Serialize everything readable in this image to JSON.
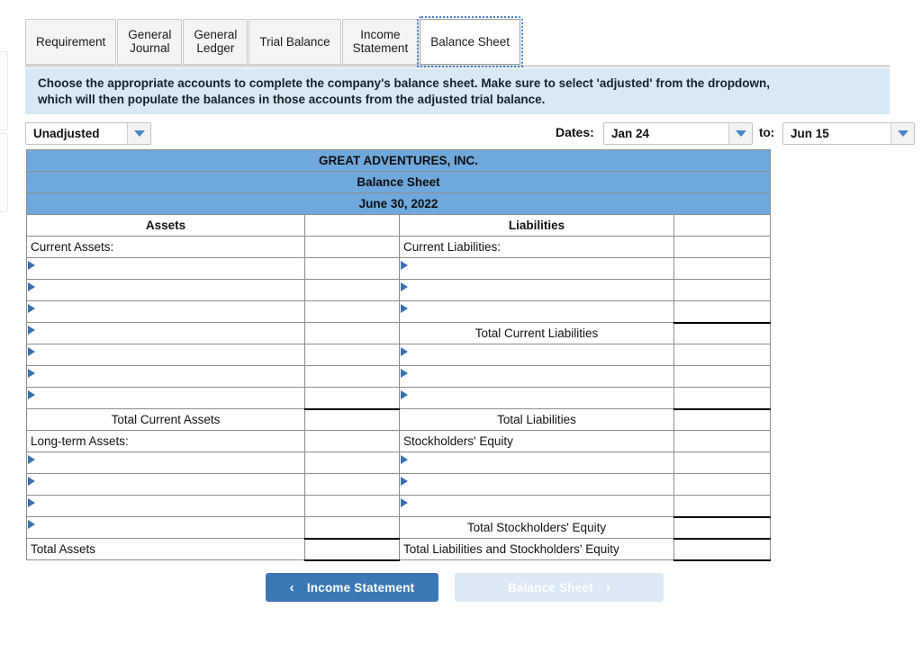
{
  "tabs": [
    {
      "label": "Requirement",
      "active": false
    },
    {
      "label": "General\nJournal",
      "active": false
    },
    {
      "label": "General\nLedger",
      "active": false
    },
    {
      "label": "Trial Balance",
      "active": false
    },
    {
      "label": "Income\nStatement",
      "active": false
    },
    {
      "label": "Balance Sheet",
      "active": true
    }
  ],
  "banner": {
    "line1": "Choose the appropriate accounts to complete the company's balance sheet. Make sure to select 'adjusted' from the dropdown,",
    "line2": "which will then populate the balances in those accounts from the adjusted trial balance."
  },
  "toolbar": {
    "adjustment_value": "Unadjusted",
    "dates_label": "Dates:",
    "date_from_value": "Jan 24",
    "to_label": "to:",
    "date_to_value": "Jun 15"
  },
  "sheet": {
    "company": "GREAT ADVENTURES, INC.",
    "statement": "Balance Sheet",
    "date": "June 30, 2022",
    "col_assets": "Assets",
    "col_liabilities": "Liabilities",
    "rows": [
      {
        "left": "Current Assets:",
        "left_style": "lbl",
        "left_picker": false,
        "left_amt": "none",
        "right": "Current Liabilities:",
        "right_style": "lbl",
        "right_picker": false,
        "right_amt": "none"
      },
      {
        "left": "",
        "left_style": "lbl",
        "left_picker": true,
        "left_amt": "plain",
        "right": "",
        "right_style": "lbl",
        "right_picker": true,
        "right_amt": "plain"
      },
      {
        "left": "",
        "left_style": "lbl",
        "left_picker": true,
        "left_amt": "plain",
        "right": "",
        "right_style": "lbl",
        "right_picker": true,
        "right_amt": "plain"
      },
      {
        "left": "",
        "left_style": "lbl",
        "left_picker": true,
        "left_amt": "plain",
        "right": "",
        "right_style": "lbl",
        "right_picker": true,
        "right_amt": "plain"
      },
      {
        "left": "",
        "left_style": "lbl",
        "left_picker": true,
        "left_amt": "plain",
        "right": "Total Current Liabilities",
        "right_style": "total",
        "right_picker": false,
        "right_amt": "ruled"
      },
      {
        "left": "",
        "left_style": "lbl",
        "left_picker": true,
        "left_amt": "plain",
        "right": "",
        "right_style": "lbl",
        "right_picker": true,
        "right_amt": "plain"
      },
      {
        "left": "",
        "left_style": "lbl",
        "left_picker": true,
        "left_amt": "plain",
        "right": "",
        "right_style": "lbl",
        "right_picker": true,
        "right_amt": "plain"
      },
      {
        "left": "",
        "left_style": "lbl",
        "left_picker": true,
        "left_amt": "plain",
        "right": "",
        "right_style": "lbl",
        "right_picker": true,
        "right_amt": "plain"
      },
      {
        "left": "Total Current Assets",
        "left_style": "total",
        "left_picker": false,
        "left_amt": "ruled",
        "right": "Total Liabilities",
        "right_style": "total",
        "right_picker": false,
        "right_amt": "ruled"
      },
      {
        "left": "Long-term Assets:",
        "left_style": "lbl",
        "left_picker": false,
        "left_amt": "plain",
        "right": "Stockholders' Equity",
        "right_style": "lbl",
        "right_picker": false,
        "right_amt": "plain"
      },
      {
        "left": "",
        "left_style": "lbl",
        "left_picker": true,
        "left_amt": "plain",
        "right": "",
        "right_style": "lbl",
        "right_picker": true,
        "right_amt": "plain"
      },
      {
        "left": "",
        "left_style": "lbl",
        "left_picker": true,
        "left_amt": "plain",
        "right": "",
        "right_style": "lbl",
        "right_picker": true,
        "right_amt": "plain"
      },
      {
        "left": "",
        "left_style": "lbl",
        "left_picker": true,
        "left_amt": "plain",
        "right": "",
        "right_style": "lbl",
        "right_picker": true,
        "right_amt": "plain"
      },
      {
        "left": "",
        "left_style": "lbl",
        "left_picker": true,
        "left_amt": "plain",
        "right": "Total Stockholders' Equity",
        "right_style": "total",
        "right_picker": false,
        "right_amt": "ruled"
      },
      {
        "left": "Total Assets",
        "left_style": "lbl",
        "left_picker": false,
        "left_amt": "dbl",
        "right": "Total Liabilities and Stockholders' Equity",
        "right_style": "lbl",
        "right_picker": false,
        "right_amt": "dbl"
      }
    ]
  },
  "footer": {
    "prev_label": "Income Statement",
    "prev_chevron": "‹",
    "next_label": "Balance Sheet",
    "next_chevron": "›"
  },
  "colors": {
    "header_blue": "#6fa8dc",
    "banner_blue": "#d7e9f6",
    "accent_blue": "#3b78b5",
    "picker_blue": "#3b6fb0"
  }
}
